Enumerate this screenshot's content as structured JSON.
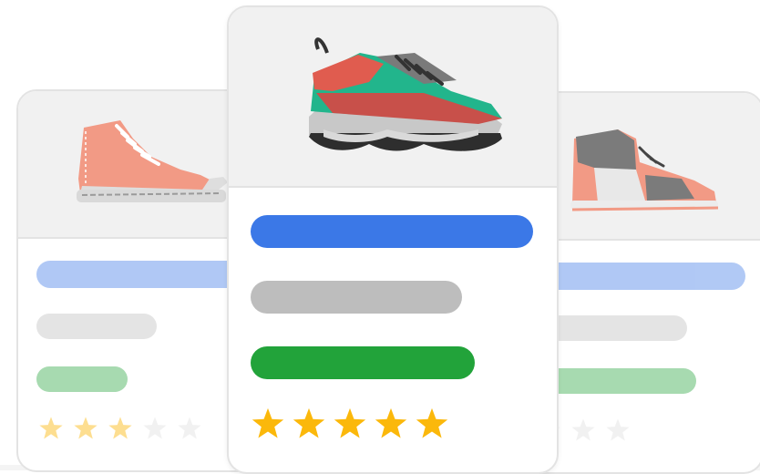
{
  "cards": [
    {
      "id": "left",
      "product_icon": "high-top-sneaker-icon",
      "rating": 3,
      "max_rating": 5
    },
    {
      "id": "center",
      "product_icon": "running-shoe-icon",
      "rating": 5,
      "max_rating": 5
    },
    {
      "id": "right",
      "product_icon": "basketball-sneaker-icon",
      "rating": 1,
      "max_rating": 5
    }
  ],
  "colors": {
    "title_bar": "#3b78e7",
    "subtitle_bar": "#bdbdbd",
    "price_bar": "#22a33a",
    "star": "#fbb80b",
    "star_empty": "#f1f1f1",
    "card_border": "#e3e3e3",
    "image_bg": "#f1f1f1"
  }
}
